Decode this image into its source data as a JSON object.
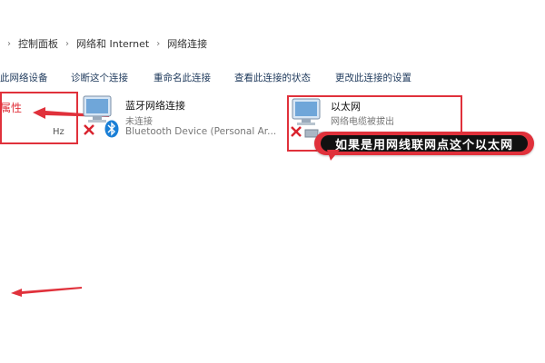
{
  "breadcrumb": {
    "items": [
      "控制面板",
      "网络和 Internet",
      "网络连接"
    ]
  },
  "toolbar": {
    "items": [
      "此网络设备",
      "诊断这个连接",
      "重命名此连接",
      "查看此连接的状态",
      "更改此连接的设置"
    ]
  },
  "left_panel": {
    "properties_label": "属性",
    "hz_label": "Hz"
  },
  "connections": [
    {
      "name": "蓝牙网络连接",
      "status": "未连接",
      "device": "Bluetooth Device (Personal Ar...",
      "icon": "network-computer-icon",
      "overlay_icon": "disconnected-x-icon",
      "badge_icon": "bluetooth-icon"
    },
    {
      "name": "以太网",
      "status": "网络电缆被拔出",
      "device": "",
      "icon": "network-computer-icon",
      "overlay_icon": "disconnected-x-icon"
    }
  ],
  "annotation": {
    "callout_text": "如果是用网线联网点这个以太网"
  },
  "colors": {
    "annotation_red": "#e0313b",
    "callout_bg": "#111111",
    "toolbar_text": "#1f3a5c"
  }
}
